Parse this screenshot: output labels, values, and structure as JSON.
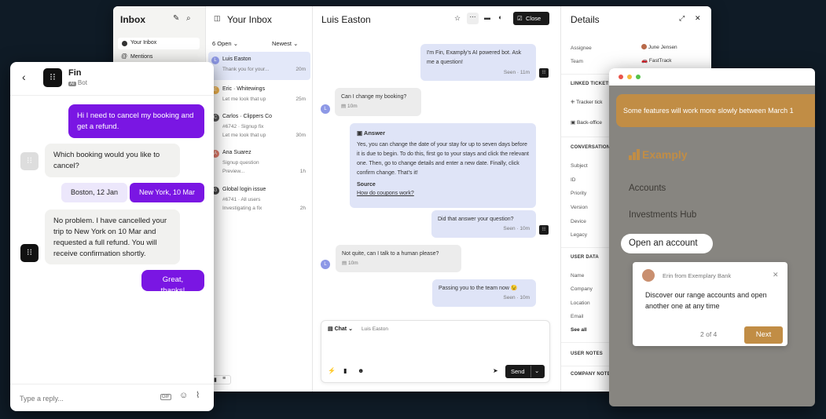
{
  "nav": {
    "title": "Inbox",
    "items": [
      {
        "label": "Your Inbox"
      },
      {
        "label": "Mentions"
      }
    ]
  },
  "list": {
    "title": "Your Inbox",
    "filter": "6 Open",
    "sort": "Newest",
    "items": [
      {
        "initial": "L",
        "name": "Luis Easton",
        "line1": "Thank you for your...",
        "line2": "",
        "time": "20m",
        "color": "#8d98e6"
      },
      {
        "initial": "E",
        "name": "Eric · Whitewings",
        "line1": "Let me look that up",
        "line2": "",
        "time": "25m",
        "color": "#f0b24a"
      },
      {
        "initial": "C",
        "name": "Carlos · Clippers Co",
        "line1": "#6742 · Signup fix",
        "line2": "Let me look that up",
        "time": "30m",
        "color": "#555"
      },
      {
        "initial": "A",
        "name": "Ana Suarez",
        "line1": "Signup question",
        "line2": "Preview...",
        "time": "1h",
        "color": "#e07a6a"
      },
      {
        "initial": "G",
        "name": "Global login issue",
        "line1": "#6741 · All users",
        "line2": "Investigating a fix",
        "time": "2h",
        "color": "#444"
      }
    ]
  },
  "conv": {
    "title": "Luis Easton",
    "close_label": "Close",
    "avatar_initial": "L",
    "msg1": "I'm Fin, Examply's AI powered bot. Ask me a question!",
    "msg1_meta": "Seen · 11m",
    "msg2": "Can I change my booking?",
    "msg2_meta": "10m",
    "answer_title": "Answer",
    "answer_text": "Yes, you can change the date of your stay for up to seven days before it is due to begin. To do this, first go to your stays and click the relevant one. Then, go to change details and enter a new date. Finally, click confirm change. That's it!",
    "source_label": "Source",
    "source_link": "How do coupons work?",
    "msg3": "Did that answer your question?",
    "msg3_meta": "Seen · 10m",
    "msg4": "Not quite, can I talk to a human please?",
    "msg4_meta": "10m",
    "msg5": "Passing you to the team now 😉",
    "msg5_meta": "Seen · 10m",
    "composer_channel": "Chat",
    "composer_to": "Luis Easton",
    "send_label": "Send"
  },
  "details": {
    "title": "Details",
    "assignee_label": "Assignee",
    "assignee_value": "June Jensen",
    "team_label": "Team",
    "team_value": "FastTrack",
    "linked_title": "LINKED TICKETS",
    "linked1": "Tracker tick",
    "linked2": "Back-office",
    "conv_title": "CONVERSATION",
    "conv_fields": [
      "Subject",
      "ID",
      "Priority",
      "Version",
      "Device",
      "Legacy"
    ],
    "user_title": "USER DATA",
    "user_fields": [
      "Name",
      "Company",
      "Location",
      "Email"
    ],
    "see_all": "See all",
    "notes_title": "USER NOTES",
    "company_title": "COMPANY NOTE"
  },
  "fin": {
    "name": "Fin",
    "bot_badge": "AI",
    "bot_label": "Bot",
    "m1": "Hi I need to cancel my booking and get a refund.",
    "m2": "Which booking would you like to cancel?",
    "opt1": "Boston, 12 Jan",
    "opt2": "New York, 10 Mar",
    "m3": "No problem. I have cancelled your trip to New York on 10 Mar and requested a full refund. You will receive confirmation shortly.",
    "m4": "Great, thanks!",
    "reply_placeholder": "Type a reply..."
  },
  "examply": {
    "banner": "Some features will work more slowly between March 1",
    "brand": "Examply",
    "nav": [
      "Accounts",
      "Investments Hub",
      "Open an account"
    ],
    "tip_from": "Erin from Exemplary Bank",
    "tip_text": "Discover our range accounts and open another one at any time",
    "tip_step": "2 of 4",
    "tip_next": "Next"
  },
  "colors": {
    "fin_purple": "#7a16e3",
    "examply_gold": "#c18d45",
    "bubble_blue": "#dfe4f7"
  }
}
